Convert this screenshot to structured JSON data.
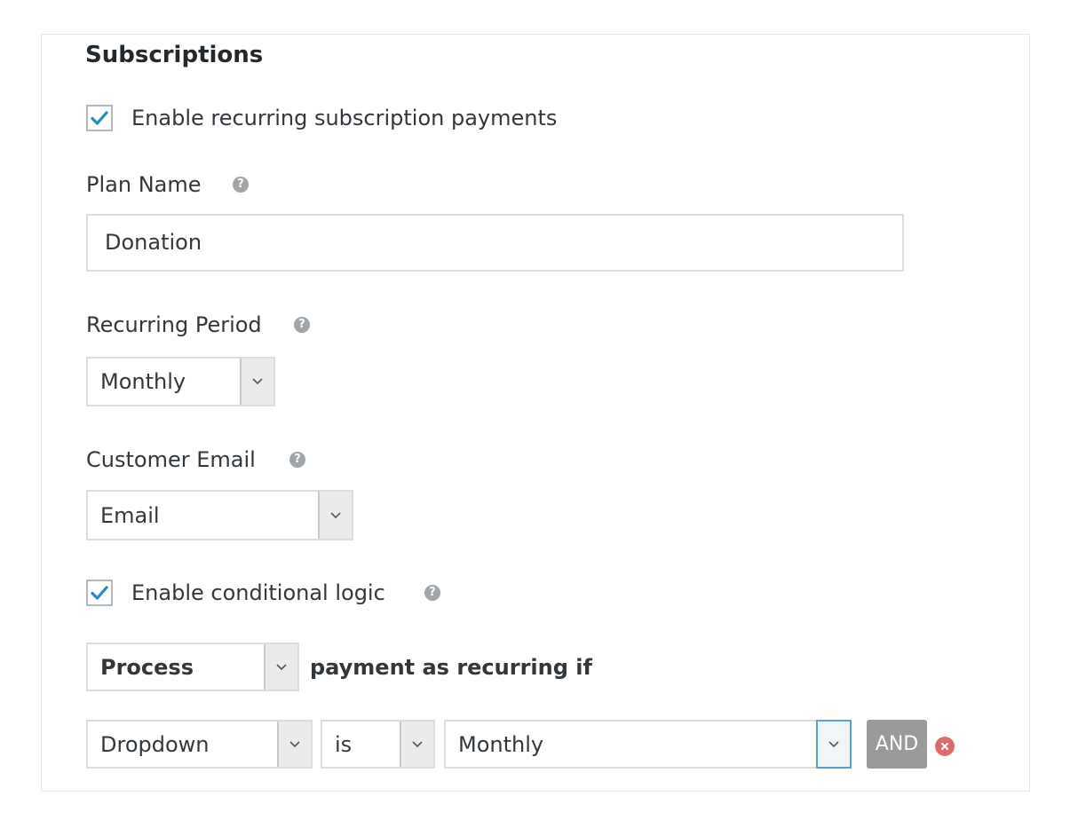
{
  "section": {
    "title": "Subscriptions"
  },
  "enable_recurring": {
    "label": "Enable recurring subscription payments",
    "checked": true
  },
  "plan_name": {
    "label": "Plan Name",
    "value": "Donation"
  },
  "recurring_period": {
    "label": "Recurring Period",
    "selected": "Monthly"
  },
  "customer_email": {
    "label": "Customer Email",
    "selected": "Email"
  },
  "conditional_logic": {
    "label": "Enable conditional logic",
    "checked": true,
    "action_selected": "Process",
    "action_suffix": "payment as recurring if",
    "rule": {
      "field_selected": "Dropdown",
      "operator_selected": "is",
      "value_selected": "Monthly",
      "and_label": "AND"
    }
  },
  "icons": {
    "checkmark": "checkmark-icon",
    "help": "question-circle-icon",
    "chevron": "chevron-down-icon",
    "remove": "close-circle-icon"
  },
  "colors": {
    "checkmark": "#1e8cbe",
    "help_icon": "#a0a5aa",
    "remove_icon": "#e06b6b",
    "and_button": "#9a9a9a",
    "focus_border": "#5b9dd9"
  }
}
